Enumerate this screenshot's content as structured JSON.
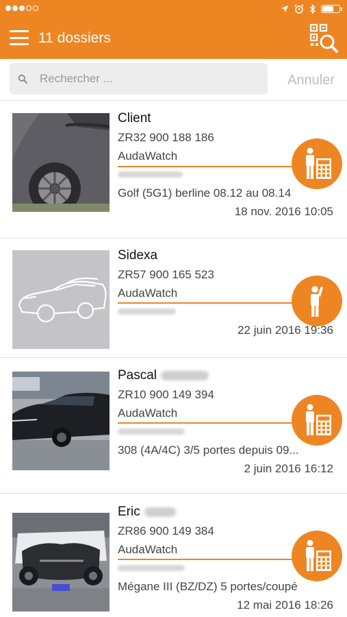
{
  "header": {
    "title": "11 dossiers",
    "menu_icon": "hamburger-menu-icon",
    "action_icon": "qr-search-icon",
    "accent_color": "#EE8523"
  },
  "status_bar": {
    "signal_dots_filled": 3,
    "signal_dots_total": 5,
    "icons": [
      "location-arrow-icon",
      "alarm-icon",
      "bluetooth-icon",
      "battery-icon"
    ]
  },
  "search": {
    "placeholder": "Rechercher ...",
    "value": "",
    "cancel_label": "Annuler"
  },
  "dossiers": [
    {
      "name": "Client",
      "reference": "ZR32 900 188 186",
      "source": "AudaWatch",
      "vehicle": "Golf (5G1) berline 08.12 au 08.14",
      "date": "18 nov. 2016 10:05",
      "badge_icon": "person-calculator-icon"
    },
    {
      "name": "Sidexa",
      "reference": "ZR57 900 165 523",
      "source": "AudaWatch",
      "vehicle": "",
      "date": "22 juin 2016 19:36",
      "badge_icon": "person-raising-hand-icon"
    },
    {
      "name": "Pascal",
      "reference": "ZR10 900 149 394",
      "source": "AudaWatch",
      "vehicle": "308 (4A/4C) 3/5 portes depuis 09...",
      "date": "2 juin 2016 16:12",
      "badge_icon": "person-calculator-icon"
    },
    {
      "name": "Eric",
      "reference": "ZR86 900 149 384",
      "source": "AudaWatch",
      "vehicle": "Mégane III (BZ/DZ) 5 portes/coupé",
      "date": "12 mai 2016 18:26",
      "badge_icon": "person-calculator-icon"
    }
  ]
}
